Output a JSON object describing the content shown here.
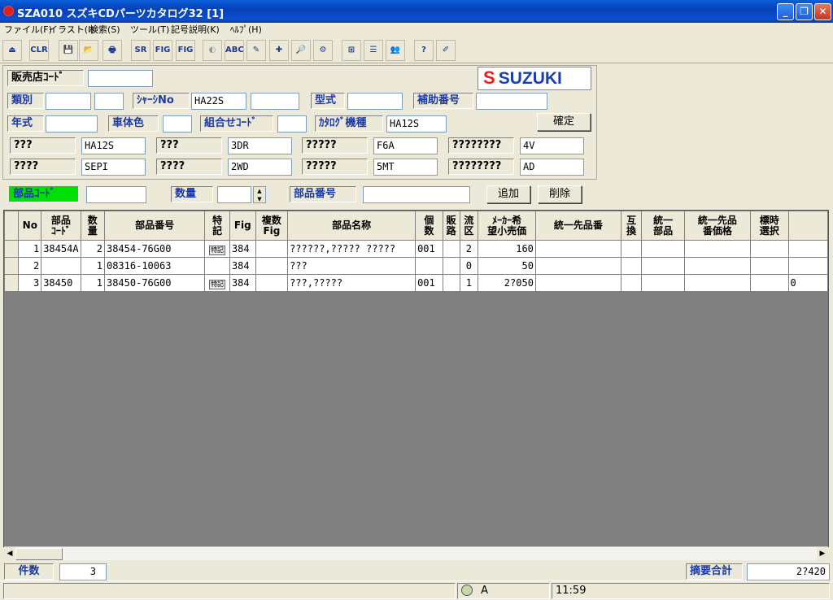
{
  "window": {
    "title": "SZA010 スズキCDパーツカタログ32 [1]",
    "controls": [
      "_",
      "❐",
      "✕"
    ]
  },
  "menu": [
    "ファイル(F)",
    "イラスト(I)",
    "検索(S)",
    "ツール(T)",
    "記号説明(K)",
    "ﾍﾙﾌﾟ(H)"
  ],
  "toolbar": {
    "buttons": [
      "⏏",
      "CLR",
      "💾",
      "📂",
      "🖶",
      "SR",
      "FIG",
      "FIG",
      "◐",
      "ABC",
      "✎",
      "✚",
      "🔎",
      "⚙",
      "⊞",
      "☰",
      "👥",
      "?",
      "✐"
    ]
  },
  "form": {
    "shop_code_label": "販売店ｺｰﾄﾞ",
    "shop_code_value": "",
    "logo_text": "SUZUKI",
    "row1": {
      "type_label": "類別",
      "chassis_label": "ｼｬｰｼNo",
      "chassis_value": "HA22S",
      "model_label": "型式",
      "aux_label": "補助番号"
    },
    "row2": {
      "year_label": "年式",
      "color_label": "車体色",
      "combo_label": "組合せｺｰﾄﾞ",
      "catalog_label": "ｶﾀﾛｸﾞ機種",
      "catalog_value": "HA12S",
      "confirm_button": "確定"
    },
    "spec_row1": [
      {
        "label": "???",
        "value": "HA12S"
      },
      {
        "label": "???",
        "value": "3DR"
      },
      {
        "label": "?????",
        "value": "F6A"
      },
      {
        "label": "????????",
        "value": "4V"
      }
    ],
    "spec_row2": [
      {
        "label": "????",
        "value": "SEPI"
      },
      {
        "label": "????",
        "value": "2WD"
      },
      {
        "label": "?????",
        "value": "5MT"
      },
      {
        "label": "????????",
        "value": "AD"
      }
    ]
  },
  "entry": {
    "part_code_label": "部品ｺｰﾄﾞ",
    "qty_label": "数量",
    "part_number_label": "部品番号",
    "add_button": "追加",
    "delete_button": "削除"
  },
  "grid": {
    "headers": [
      "",
      "No",
      "部品\nｺｰﾄﾞ",
      "数\n量",
      "部品番号",
      "特\n記",
      "Fig",
      "複数\nFig",
      "部品名称",
      "個\n数",
      "販\n路",
      "流\n区",
      "ﾒｰｶｰ希\n望小売価",
      "統一先品番",
      "互\n換",
      "統一\n部品",
      "統一先品\n番価格",
      "標時\n選択",
      ""
    ],
    "rows": [
      {
        "no": "1",
        "code": "38454A",
        "qty": "2",
        "part_no": "38454-76G00",
        "tokki": "特記",
        "fig": "384",
        "multi": "",
        "name": "??????,????? ?????",
        "kosu": "001",
        "hanro": "",
        "ryuku": "2",
        "price": "160",
        "unified": "",
        "gokan": "",
        "u_part": "",
        "u_price": "",
        "hyoji": "",
        "extra": ""
      },
      {
        "no": "2",
        "code": "",
        "qty": "1",
        "part_no": "08316-10063",
        "tokki": "",
        "fig": "384",
        "multi": "",
        "name": "???",
        "kosu": "",
        "hanro": "",
        "ryuku": "0",
        "price": "50",
        "unified": "",
        "gokan": "",
        "u_part": "",
        "u_price": "",
        "hyoji": "",
        "extra": ""
      },
      {
        "no": "3",
        "code": "38450",
        "qty": "1",
        "part_no": "38450-76G00",
        "tokki": "特記",
        "fig": "384",
        "multi": "",
        "name": "???,?????",
        "kosu": "001",
        "hanro": "",
        "ryuku": "1",
        "price": "2?050",
        "unified": "",
        "gokan": "",
        "u_part": "",
        "u_price": "",
        "hyoji": "",
        "extra": "0"
      }
    ]
  },
  "footer": {
    "count_label": "件数",
    "count_value": "3",
    "total_label": "摘要合計",
    "total_value": "2?420"
  },
  "status": {
    "mode": "A",
    "time": "11:59"
  }
}
